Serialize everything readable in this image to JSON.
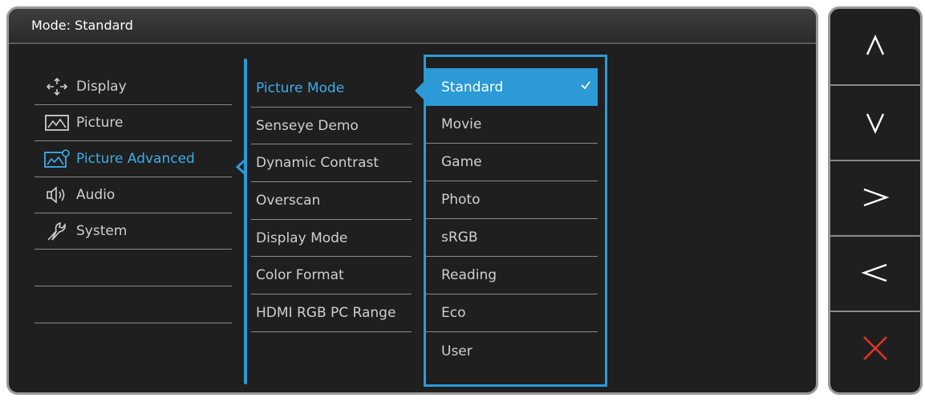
{
  "header": {
    "title": "Mode: Standard"
  },
  "menu": {
    "items": [
      {
        "label": "Display",
        "icon": "display-icon",
        "active": false
      },
      {
        "label": "Picture",
        "icon": "picture-icon",
        "active": false
      },
      {
        "label": "Picture Advanced",
        "icon": "picture-advanced-icon",
        "active": true
      },
      {
        "label": "Audio",
        "icon": "audio-icon",
        "active": false
      },
      {
        "label": "System",
        "icon": "system-icon",
        "active": false
      }
    ]
  },
  "submenu": {
    "items": [
      {
        "label": "Picture Mode",
        "active": true
      },
      {
        "label": "Senseye Demo",
        "active": false
      },
      {
        "label": "Dynamic Contrast",
        "active": false
      },
      {
        "label": "Overscan",
        "active": false
      },
      {
        "label": "Display Mode",
        "active": false
      },
      {
        "label": "Color Format",
        "active": false
      },
      {
        "label": "HDMI RGB PC Range",
        "active": false
      }
    ]
  },
  "options": {
    "items": [
      {
        "label": "Standard",
        "selected": true
      },
      {
        "label": "Movie",
        "selected": false
      },
      {
        "label": "Game",
        "selected": false
      },
      {
        "label": "Photo",
        "selected": false
      },
      {
        "label": "sRGB",
        "selected": false
      },
      {
        "label": "Reading",
        "selected": false
      },
      {
        "label": "Eco",
        "selected": false
      },
      {
        "label": "User",
        "selected": false
      }
    ]
  },
  "keys": [
    {
      "icon": "up-icon",
      "color": "#ffffff"
    },
    {
      "icon": "down-icon",
      "color": "#ffffff"
    },
    {
      "icon": "right-icon",
      "color": "#ffffff"
    },
    {
      "icon": "left-icon",
      "color": "#ffffff"
    },
    {
      "icon": "close-icon",
      "color": "#e0332b"
    }
  ],
  "colors": {
    "accent": "#2b9ad6",
    "panel": "#1f1f1f",
    "text": "#cfcfcf",
    "active_text": "#3aaeea"
  }
}
